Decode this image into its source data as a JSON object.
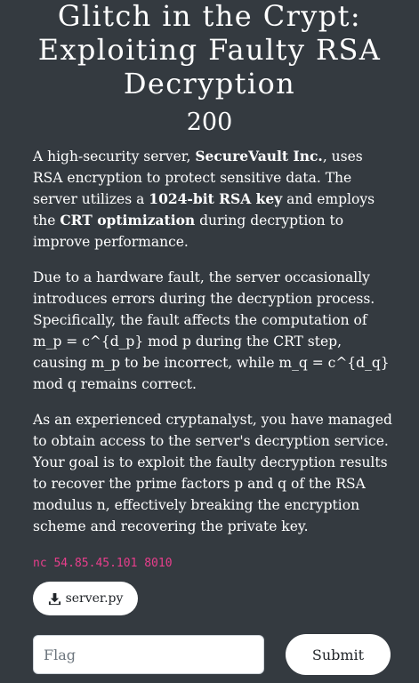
{
  "challenge": {
    "title": "Glitch in the Crypt: Exploiting Faulty RSA Decryption",
    "points": "200",
    "description": {
      "p1": {
        "t1": "A high-security server, ",
        "b1": "SecureVault Inc.",
        "t2": ", uses RSA encryption to protect sensitive data. The server utilizes a ",
        "b2": "1024-bit RSA key",
        "t3": " and employs the ",
        "b3": "CRT optimization",
        "t4": " during decryption to improve performance."
      },
      "p2": "Due to a hardware fault, the server occasionally introduces errors during the decryption process. Specifically, the fault affects the computation of m_p = c^{d_p} mod p during the CRT step, causing m_p to be incorrect, while m_q = c^{d_q} mod q remains correct.",
      "p3": "As an experienced cryptanalyst, you have managed to obtain access to the server's decryption service. Your goal is to exploit the faulty decryption results to recover the prime factors p and q of the RSA modulus n, effectively breaking the encryption scheme and recovering the private key."
    },
    "connection": "nc 54.85.45.101 8010",
    "file": {
      "icon": "download-icon",
      "label": "server.py"
    },
    "flag_input": {
      "placeholder": "Flag",
      "value": ""
    },
    "submit_label": "Submit"
  },
  "colors": {
    "background": "#343a40",
    "text": "#ffffff",
    "code": "#e83e8c",
    "button_bg": "#ffffff",
    "button_text": "#212529"
  }
}
